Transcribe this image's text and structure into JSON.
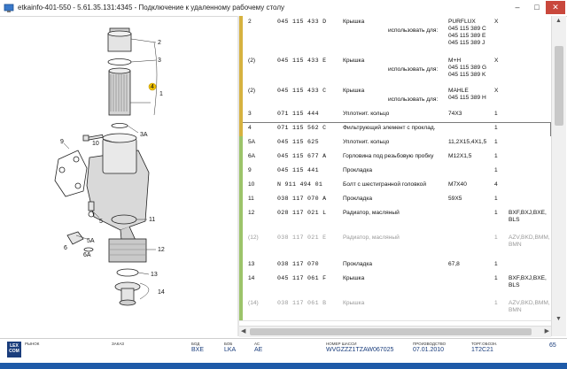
{
  "window": {
    "title": "etkainfo-401-550 - 5.61.35.131:4345 - Подключение к удаленному рабочему столу",
    "minimize": "–",
    "maximize": "□",
    "close": "✕"
  },
  "diagram": {
    "callouts": [
      "2",
      "1",
      "3",
      "3A",
      "4",
      "9",
      "10",
      "5",
      "5A",
      "6",
      "6A",
      "11",
      "12",
      "13",
      "14"
    ]
  },
  "parts": {
    "use_label": "использовать для:",
    "rows": [
      {
        "pos": "2",
        "number": "045 115 433 D",
        "name": "Крышка",
        "note": "",
        "qty": "X",
        "info": "",
        "bar_color": "#d6b240",
        "use_for": {
          "brand": "PURFLUX",
          "codes": [
            "045 115 389 C",
            "045 115 389 E",
            "045 115 389 J"
          ]
        }
      },
      {
        "pos": "(2)",
        "number": "045 115 433 E",
        "name": "Крышка",
        "note": "",
        "qty": "X",
        "info": "",
        "bar_color": "#d6b240",
        "use_for": {
          "brand": "M+H",
          "codes": [
            "045 115 389 G",
            "045 115 389 K"
          ]
        }
      },
      {
        "pos": "(2)",
        "number": "045 115 433 C",
        "name": "Крышка",
        "note": "",
        "qty": "X",
        "info": "",
        "bar_color": "#d6b240",
        "use_for": {
          "brand": "MAHLE",
          "codes": [
            "045 115 389 H"
          ]
        }
      },
      {
        "pos": "3",
        "number": "071 115 444",
        "name": "Уплотнит. кольцо",
        "note": "74X3",
        "qty": "1",
        "info": "",
        "bar_color": "#d6b240"
      },
      {
        "pos": "4",
        "number": "071 115 562 C",
        "name": "Фильтрующий элемент с проклад.",
        "note": "",
        "qty": "1",
        "info": "",
        "bar_color": "#d6b240"
      },
      {
        "pos": "5A",
        "number": "045 115 625",
        "name": "Уплотнит. кольцо",
        "note": "11,2X15,4X1,5",
        "qty": "1",
        "info": "",
        "bar_color": "#9cc46a"
      },
      {
        "pos": "6A",
        "number": "045 115 677 A",
        "name": "Горловина под резьбовую пробку",
        "note": "M12X1,5",
        "qty": "1",
        "info": "",
        "bar_color": "#9cc46a"
      },
      {
        "pos": "9",
        "number": "045 115 441",
        "name": "Прокладка",
        "note": "",
        "qty": "1",
        "info": "",
        "bar_color": "#9cc46a"
      },
      {
        "pos": "10",
        "number": "N   911 494 01",
        "name": "Болт с шестигранной головкой",
        "note": "M7X40",
        "qty": "4",
        "info": "",
        "bar_color": "#9cc46a"
      },
      {
        "pos": "11",
        "number": "038 117 070 A",
        "name": "Прокладка",
        "note": "59X5",
        "qty": "1",
        "info": "",
        "bar_color": "#9cc46a"
      },
      {
        "pos": "12",
        "number": "028 117 021 L",
        "name": "Радиатор, масляный",
        "note": "",
        "qty": "1",
        "info": "BXF,BXJ,BXE, BLS",
        "bar_color": "#9cc46a"
      },
      {
        "pos": "(12)",
        "number": "038 117 021 E",
        "name": "Радиатор, масляный",
        "note": "",
        "qty": "1",
        "info": "AZV,BKD,BMM, BMN",
        "bar_color": "#9cc46a",
        "grey": true
      },
      {
        "pos": "13",
        "number": "038 117 070",
        "name": "Прокладка",
        "note": "67,8",
        "qty": "1",
        "info": "",
        "bar_color": "#9cc46a"
      },
      {
        "pos": "14",
        "number": "045 117 061 F",
        "name": "Крышка",
        "note": "",
        "qty": "1",
        "info": "BXF,BXJ,BXE, BLS",
        "bar_color": "#9cc46a"
      },
      {
        "pos": "(14)",
        "number": "038 117 061 B",
        "name": "Крышка",
        "note": "",
        "qty": "1",
        "info": "AZV,BKD,BMM, BMN",
        "bar_color": "#9cc46a",
        "grey": true
      }
    ]
  },
  "status": {
    "logo": "LEX COM",
    "fields": [
      {
        "label": "РЫНОК",
        "value": ""
      },
      {
        "label": "ЗАКАЗ",
        "value": ""
      },
      {
        "label": "БОД",
        "value": "BXE"
      },
      {
        "label": "БОБ",
        "value": "LKA"
      },
      {
        "label": "АС",
        "value": "AE"
      },
      {
        "label": "НОМЕР ШАССИ",
        "value": "WVGZZZ1TZAW067025"
      },
      {
        "label": "ПРОИЗВОДСТВО",
        "value": "07.01.2010"
      },
      {
        "label": "ТОРГ.ОБОЗН.",
        "value": "1T2C21"
      },
      {
        "label": "",
        "value": "65"
      }
    ]
  }
}
